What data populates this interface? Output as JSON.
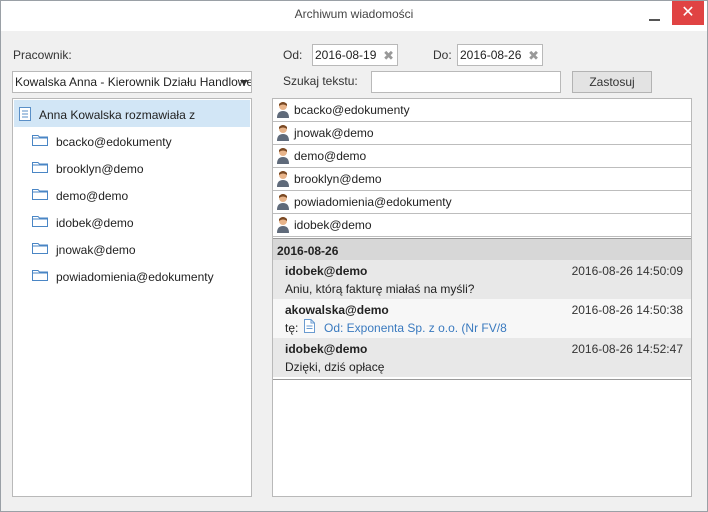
{
  "window": {
    "title": "Archiwum wiadomości",
    "close_glyph": "✕"
  },
  "filters": {
    "employee_label": "Pracownik:",
    "employee_value": "Kowalska Anna - Kierownik Działu Handlowego",
    "from_label": "Od:",
    "from_value": "2016-08-19",
    "to_label": "Do:",
    "to_value": "2016-08-26",
    "search_label": "Szukaj tekstu:",
    "search_value": "",
    "apply_label": "Zastosuj",
    "clear_glyph": "✖"
  },
  "tree": {
    "root_label": "Anna Kowalska rozmawiała z",
    "items": [
      {
        "label": "bcacko@edokumenty"
      },
      {
        "label": "brooklyn@demo"
      },
      {
        "label": "demo@demo"
      },
      {
        "label": "idobek@demo"
      },
      {
        "label": "jnowak@demo"
      },
      {
        "label": "powiadomienia@edokumenty"
      }
    ]
  },
  "participants": [
    {
      "label": "bcacko@edokumenty"
    },
    {
      "label": "jnowak@demo"
    },
    {
      "label": "demo@demo"
    },
    {
      "label": "brooklyn@demo"
    },
    {
      "label": "powiadomienia@edokumenty"
    },
    {
      "label": "idobek@demo"
    }
  ],
  "conversation": {
    "date": "2016-08-26",
    "messages": [
      {
        "author": "idobek@demo",
        "time": "2016-08-26 14:50:09",
        "text": "Aniu, którą fakturę miałaś na myśli?"
      },
      {
        "author": "akowalska@demo",
        "time": "2016-08-26 14:50:38",
        "attach_prefix": "tę:",
        "attach_link": "Od: Exponenta Sp. z o.o. (Nr FV/8"
      },
      {
        "author": "idobek@demo",
        "time": "2016-08-26 14:52:47",
        "text": "Dzięki, dziś opłacę"
      }
    ]
  },
  "colors": {
    "selection": "#d2e6f6",
    "close": "#e04343",
    "link": "#3a7abf"
  },
  "icons": [
    "minimize-icon",
    "close-icon",
    "clear-icon",
    "chevron-down-icon",
    "list-icon",
    "folder-icon",
    "user-avatar-icon",
    "document-icon"
  ]
}
